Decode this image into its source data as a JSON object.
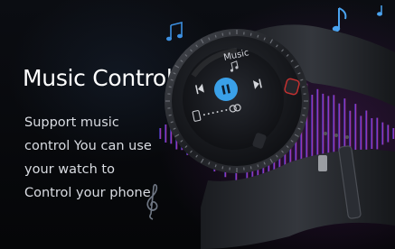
{
  "promo": {
    "headline": "Music Control",
    "description_lines": [
      "Support music",
      "control You can use",
      "your watch to",
      "Control your phone"
    ]
  },
  "watch_screen": {
    "title": "Music",
    "controls": [
      "previous-icon",
      "pause-icon",
      "next-icon"
    ],
    "volume_icons": [
      "phone-icon",
      "volume-dots",
      "link-icon"
    ]
  },
  "colors": {
    "accent_blue": "#3aa0e8",
    "waveform_purple": "#b23cc8",
    "waveform_blue": "#3b6de0",
    "note_blue": "#3c8fe0"
  }
}
